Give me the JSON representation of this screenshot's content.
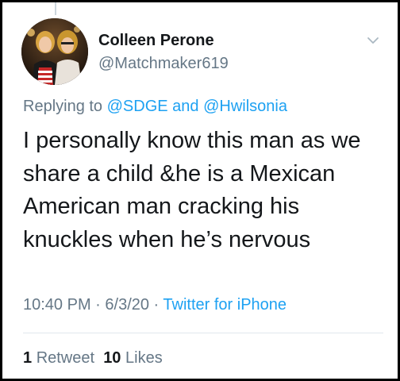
{
  "tweet": {
    "author_name": "Colleen Perone",
    "author_handle": "@Matchmaker619",
    "replying_prefix": "Replying to ",
    "replying_to": [
      "@SDGE",
      "@Hwilsonia"
    ],
    "replying_joiner": " and ",
    "text": "I personally know this man as we share a child &he is a Mexican American man cracking his knuckles when he’s nervous",
    "time": "10:40 PM",
    "date": "6/3/20",
    "separator": " · ",
    "source": "Twitter for iPhone",
    "retweets": {
      "count": "1",
      "label": "Retweet"
    },
    "likes": {
      "count": "10",
      "label": "Likes"
    }
  },
  "icons": {
    "more": "chevron-down-icon",
    "avatar": "profile-photo"
  },
  "colors": {
    "text": "#14171a",
    "secondary": "#657786",
    "link": "#1da1f2",
    "divider": "#e1e8ed",
    "frame": "#000000"
  }
}
